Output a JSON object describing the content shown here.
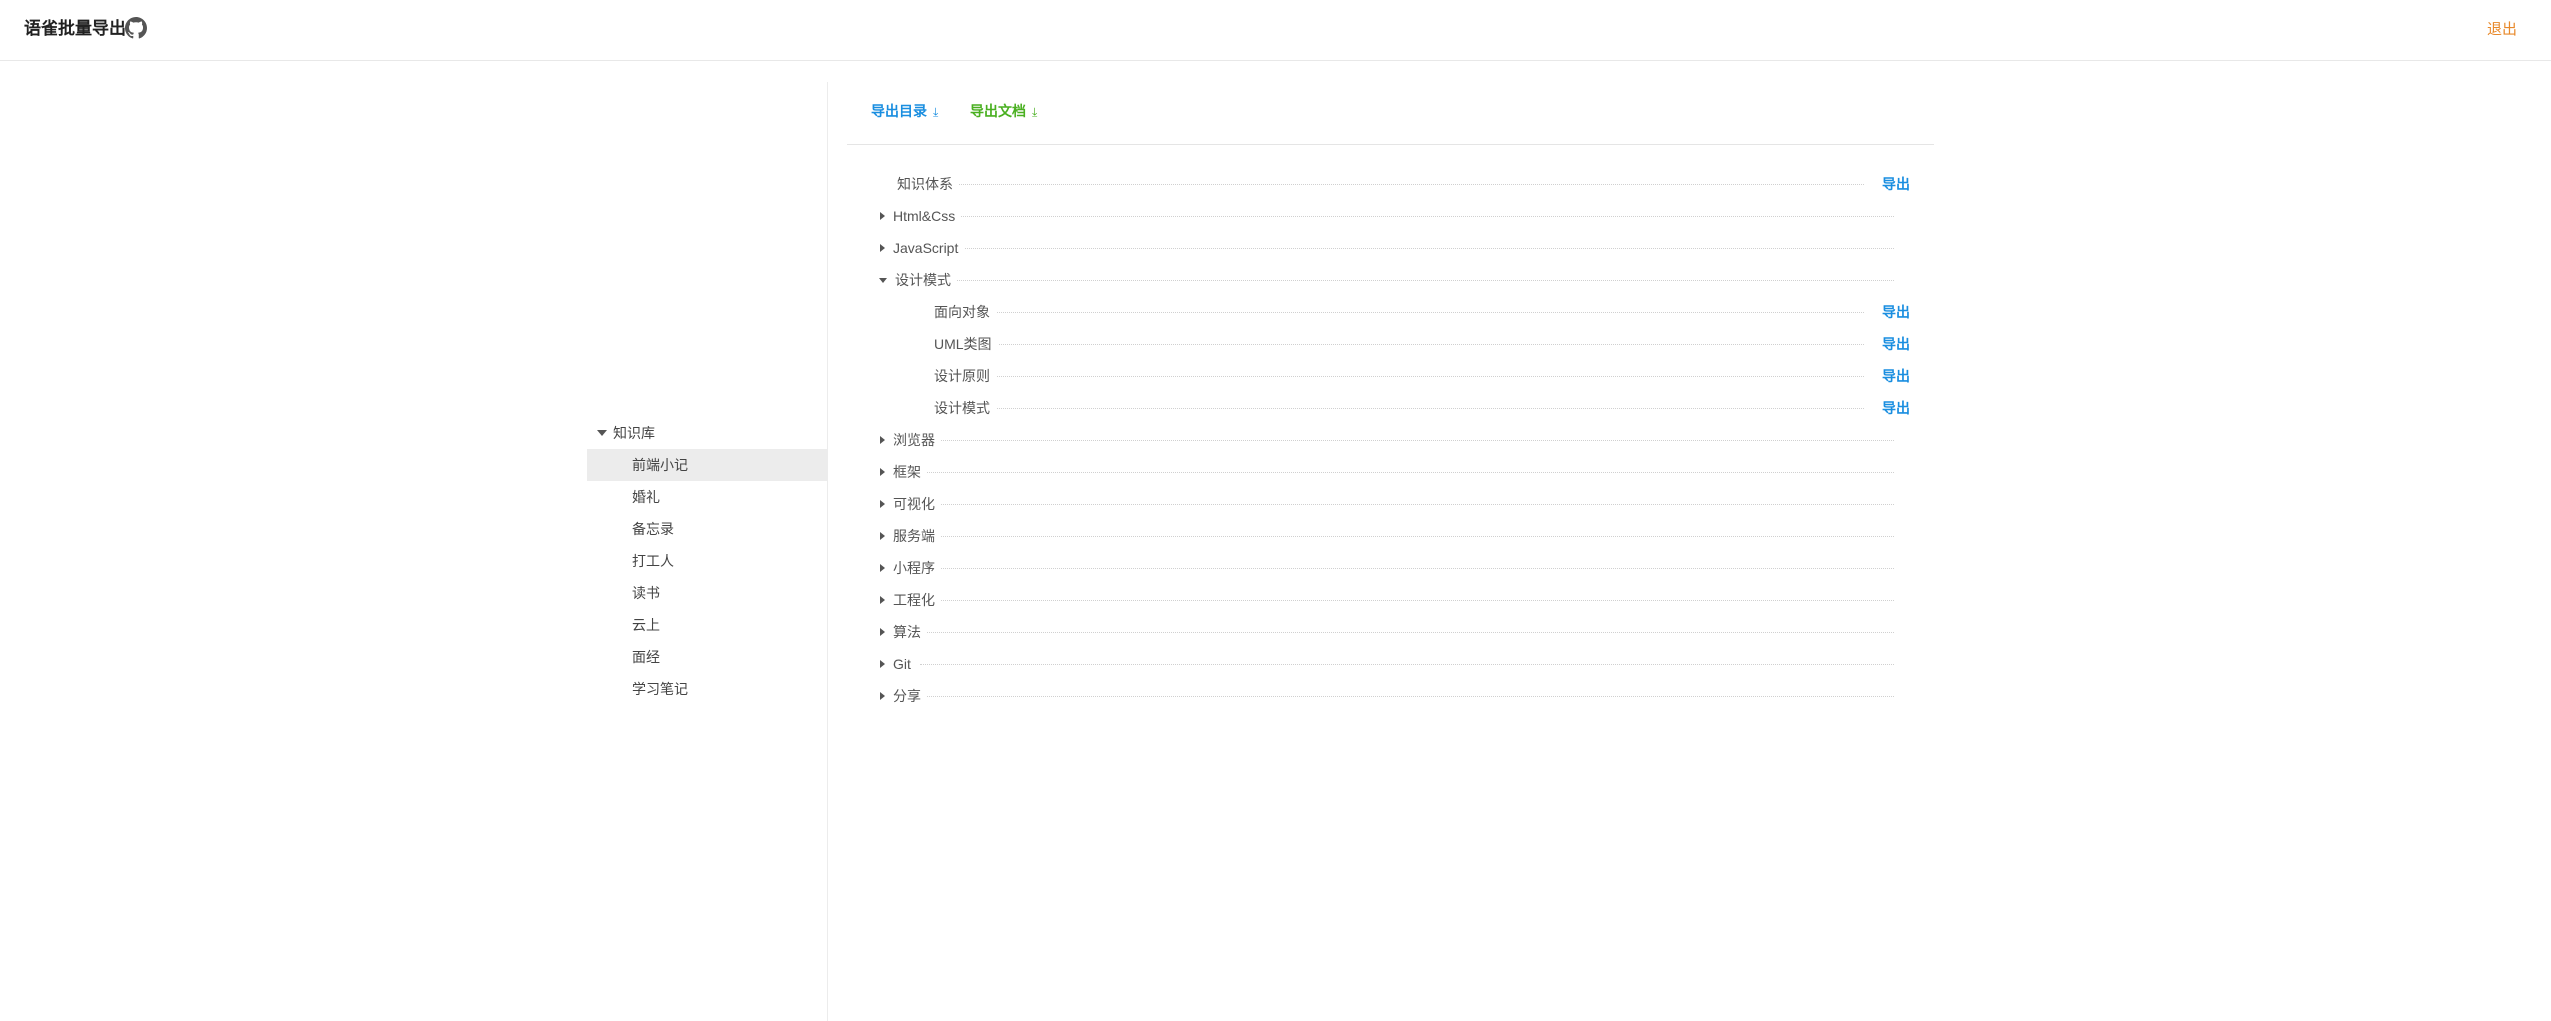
{
  "header": {
    "title": "语雀批量导出",
    "github_icon": "github-icon",
    "logout_label": "退出",
    "logout_color": "#e8892b"
  },
  "sidebar": {
    "root_label": "知识库",
    "items": [
      {
        "label": "前端小记",
        "selected": true
      },
      {
        "label": "婚礼"
      },
      {
        "label": "备忘录"
      },
      {
        "label": "打工人"
      },
      {
        "label": "读书"
      },
      {
        "label": "云上"
      },
      {
        "label": "面经"
      },
      {
        "label": "学习笔记"
      }
    ]
  },
  "toolbar": {
    "export_dir_label": "导出目录",
    "export_doc_label": "导出文档",
    "export_dir_color": "#1a8ee0",
    "export_doc_color": "#4ab021"
  },
  "docs": {
    "export_label": "导出",
    "rows": [
      {
        "label": "知识体系",
        "exportable": true
      },
      {
        "label": "Html&Css",
        "collapsed": true
      },
      {
        "label": "JavaScript",
        "collapsed": true
      },
      {
        "label": "设计模式",
        "expanded": true
      },
      {
        "label": "面向对象",
        "child": true,
        "exportable": true
      },
      {
        "label": "UML类图",
        "child": true,
        "exportable": true
      },
      {
        "label": "设计原则",
        "child": true,
        "exportable": true
      },
      {
        "label": "设计模式",
        "child": true,
        "exportable": true
      },
      {
        "label": "浏览器",
        "collapsed": true
      },
      {
        "label": "框架",
        "collapsed": true
      },
      {
        "label": "可视化",
        "collapsed": true
      },
      {
        "label": "服务端",
        "collapsed": true
      },
      {
        "label": "小程序",
        "collapsed": true
      },
      {
        "label": "工程化",
        "collapsed": true
      },
      {
        "label": "算法",
        "collapsed": true
      },
      {
        "label": "Git",
        "collapsed": true
      },
      {
        "label": "分享",
        "collapsed": true
      }
    ]
  }
}
